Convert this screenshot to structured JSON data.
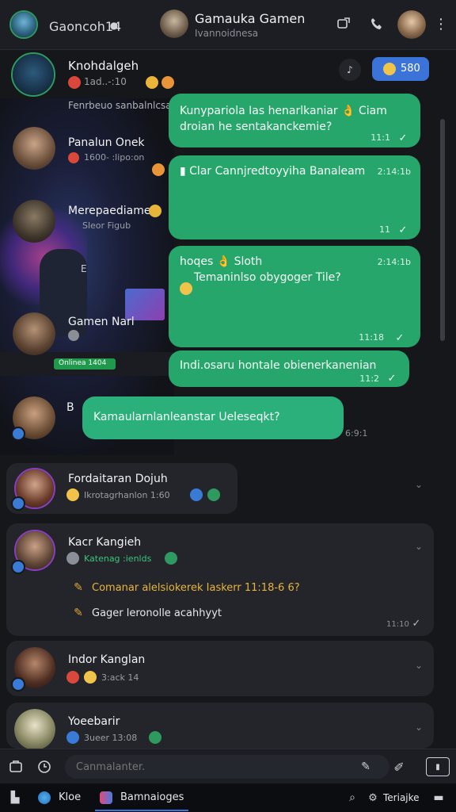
{
  "header": {
    "left_title": "Gaoncoh14",
    "chat_title": "Gamauka Gamen",
    "chat_subtitle": "Ivannoidnesa"
  },
  "action_button": {
    "label": "580"
  },
  "messages": [
    {
      "text": "Kunypariola Ias henarlkaniar 👌 Ciam droian he sentakanckemie?",
      "time": "11:1"
    },
    {
      "text": "▮ Clar Cannjredtoyyiha Banaleam",
      "time_top": "2:14:1b",
      "time": "11"
    },
    {
      "text_line1": "hoqes 👌 Sloth",
      "text_line2": "Temaninlso obygoger Tile?",
      "time_top": "2:14:1b",
      "time": "11:18"
    },
    {
      "text": "Indi.osaru hontale obienerkanenian",
      "time": "11:2"
    },
    {
      "text": "Kamaularnlanleanstar Ueleseqkt?",
      "time": "6:9:1"
    }
  ],
  "contacts": [
    {
      "name": "Knohdalgeh",
      "meta": "1ad..-:10"
    },
    {
      "name": "Panalun Onek",
      "meta": "1600- :lipo:on"
    },
    {
      "name": "Merepaediamert",
      "meta": "Sleor Figub"
    },
    {
      "name": "Gamen Narl",
      "meta": "Onlinea 1404"
    },
    {
      "name": "B",
      "meta": ""
    }
  ],
  "overlay_header": "Fenrbeuo sanbalnlcsaerlea",
  "cards": [
    {
      "name": "Fordaitaran Dojuh",
      "meta": "Ikrotagrhanlon 1:60"
    },
    {
      "name": "Kacr Kangieh",
      "meta": "Katenag :ienlds",
      "line1": "Comanar alelsiokerek Iaskerr 11:18-6 6?",
      "line2": "Gager leronolle acahhyyt",
      "time": "11:10"
    },
    {
      "name": "Indor Kanglan",
      "meta": "3:ack  14"
    },
    {
      "name": "Yoeebarir",
      "meta": "3ueer 13:08"
    }
  ],
  "input": {
    "placeholder": "Canmalanter."
  },
  "taskbar": {
    "app1": "Kloe",
    "app2": "Bamnaioges",
    "tray": "Teriajke"
  },
  "colors": {
    "accent_green": "#27a66b",
    "background": "#15171b",
    "blue": "#3a7bd5"
  }
}
